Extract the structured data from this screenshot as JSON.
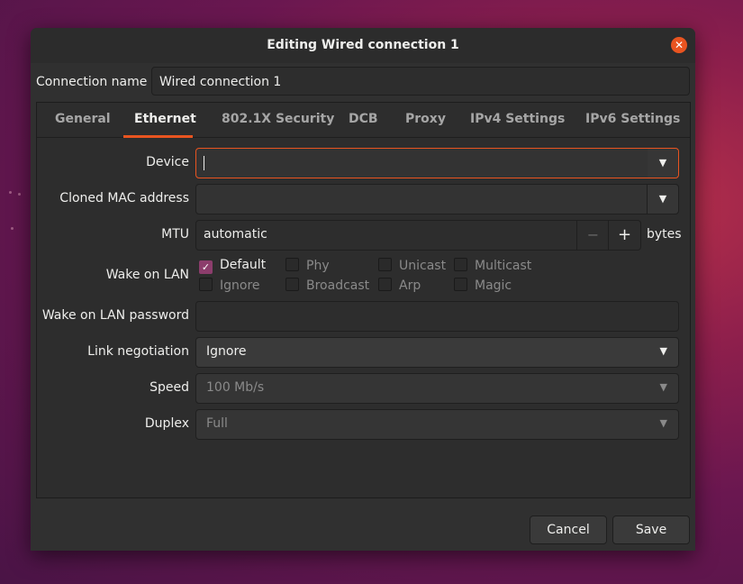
{
  "dialog": {
    "title": "Editing Wired connection 1"
  },
  "connection": {
    "name_label": "Connection name",
    "name_value": "Wired connection 1"
  },
  "tabs": [
    {
      "label": "General"
    },
    {
      "label": "Ethernet"
    },
    {
      "label": "802.1X Security"
    },
    {
      "label": "DCB"
    },
    {
      "label": "Proxy"
    },
    {
      "label": "IPv4 Settings"
    },
    {
      "label": "IPv6 Settings"
    }
  ],
  "ethernet": {
    "device_label": "Device",
    "device_value": "",
    "cloned_mac_label": "Cloned MAC address",
    "cloned_mac_value": "",
    "mtu_label": "MTU",
    "mtu_value": "automatic",
    "mtu_minus": "−",
    "mtu_plus": "+",
    "mtu_unit": "bytes",
    "wol_label": "Wake on LAN",
    "wol_options": [
      {
        "label": "Default",
        "checked": true
      },
      {
        "label": "Phy",
        "checked": false
      },
      {
        "label": "Unicast",
        "checked": false
      },
      {
        "label": "Multicast",
        "checked": false
      },
      {
        "label": "Ignore",
        "checked": false
      },
      {
        "label": "Broadcast",
        "checked": false
      },
      {
        "label": "Arp",
        "checked": false
      },
      {
        "label": "Magic",
        "checked": false
      }
    ],
    "wol_password_label": "Wake on LAN password",
    "wol_password_value": "",
    "link_neg_label": "Link negotiation",
    "link_neg_value": "Ignore",
    "speed_label": "Speed",
    "speed_value": "100 Mb/s",
    "duplex_label": "Duplex",
    "duplex_value": "Full"
  },
  "buttons": {
    "cancel": "Cancel",
    "save": "Save"
  },
  "colors": {
    "accent": "#e95420",
    "checkbox": "#8c3d6c"
  }
}
